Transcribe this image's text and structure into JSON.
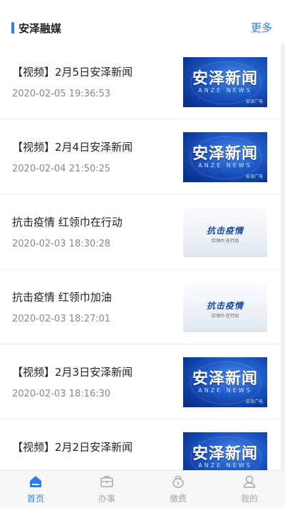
{
  "section": {
    "title": "安泽融媒",
    "more": "更多"
  },
  "news_thumb": {
    "title": "安泽新闻",
    "subtitle": "ANZE NEWS",
    "watermark": "安泽广电"
  },
  "fight_thumb": {
    "title": "抗击疫情",
    "subtitle": "红领巾 在行动"
  },
  "items": [
    {
      "headline": "【视频】2月5日安泽新闻",
      "time": "2020-02-05 19:36:53",
      "thumb": "news"
    },
    {
      "headline": "【视频】2月4日安泽新闻",
      "time": "2020-02-04 21:50:25",
      "thumb": "news"
    },
    {
      "headline": "抗击疫情 红领巾在行动",
      "time": "2020-02-03 18:30:28",
      "thumb": "fight"
    },
    {
      "headline": "抗击疫情 红领巾加油",
      "time": "2020-02-03 18:27:01",
      "thumb": "fight"
    },
    {
      "headline": "【视频】2月3日安泽新闻",
      "time": "2020-02-03 18:16:30",
      "thumb": "news"
    },
    {
      "headline": "【视频】2月2日安泽新闻",
      "time": "",
      "thumb": "news"
    }
  ],
  "tabs": [
    {
      "label": "首页",
      "icon": "home-icon",
      "active": true
    },
    {
      "label": "办事",
      "icon": "briefcase-icon",
      "active": false
    },
    {
      "label": "缴费",
      "icon": "payment-icon",
      "active": false
    },
    {
      "label": "我的",
      "icon": "user-icon",
      "active": false
    }
  ],
  "colors": {
    "accent": "#2f7fe8",
    "inactive_tab": "#a8a8a8"
  }
}
